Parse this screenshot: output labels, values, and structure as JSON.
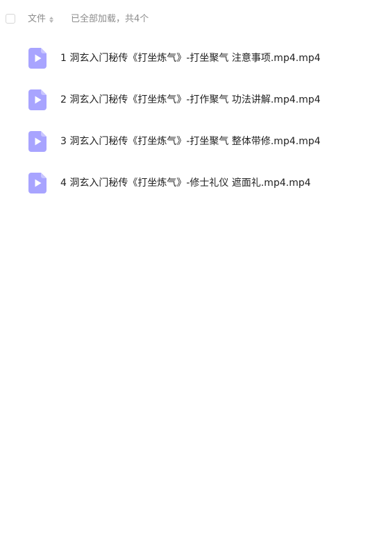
{
  "header": {
    "column_label": "文件",
    "status_text": "已全部加载，共4个"
  },
  "files": [
    {
      "name": "1 洞玄入门秘传《打坐炼气》-打坐聚气 注意事项.mp4.mp4",
      "icon": "video-file-icon"
    },
    {
      "name": "2 洞玄入门秘传《打坐炼气》-打作聚气 功法讲解.mp4.mp4",
      "icon": "video-file-icon"
    },
    {
      "name": "3 洞玄入门秘传《打坐炼气》-打坐聚气 整体带修.mp4.mp4",
      "icon": "video-file-icon"
    },
    {
      "name": "4 洞玄入门秘传《打坐炼气》-修士礼仪 遮面礼.mp4.mp4",
      "icon": "video-file-icon"
    }
  ],
  "colors": {
    "icon_fill": "#a8a4ff",
    "icon_play": "#ffffff",
    "muted_text": "#8c8c8c"
  }
}
